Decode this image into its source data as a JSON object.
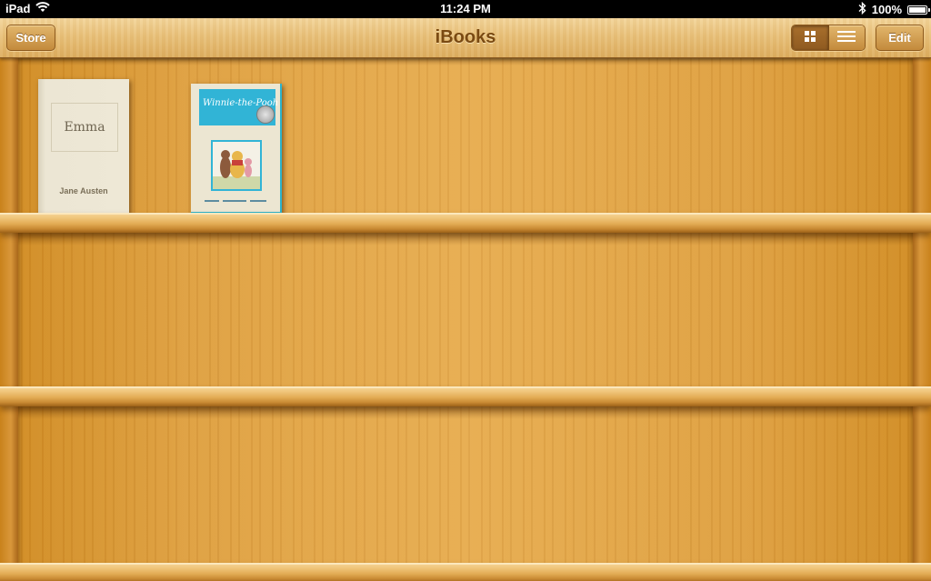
{
  "status_bar": {
    "device": "iPad",
    "time": "11:24 PM",
    "battery": "100%",
    "battery_level": 1.0
  },
  "nav_bar": {
    "title": "iBooks",
    "store_label": "Store",
    "edit_label": "Edit",
    "view_mode_selected": "grid"
  },
  "books": [
    {
      "title": "Emma",
      "author": "Jane Austen"
    },
    {
      "title": "Winnie-the-Pooh"
    }
  ],
  "colors": {
    "accent_blue": "#31b4d6",
    "title_brown": "#7a4a12",
    "wood": "#dea042"
  },
  "icons": {
    "wifi": "wifi-icon",
    "bluetooth": "bluetooth-icon",
    "battery": "battery-icon",
    "grid": "grid-view-icon",
    "list": "list-view-icon"
  }
}
